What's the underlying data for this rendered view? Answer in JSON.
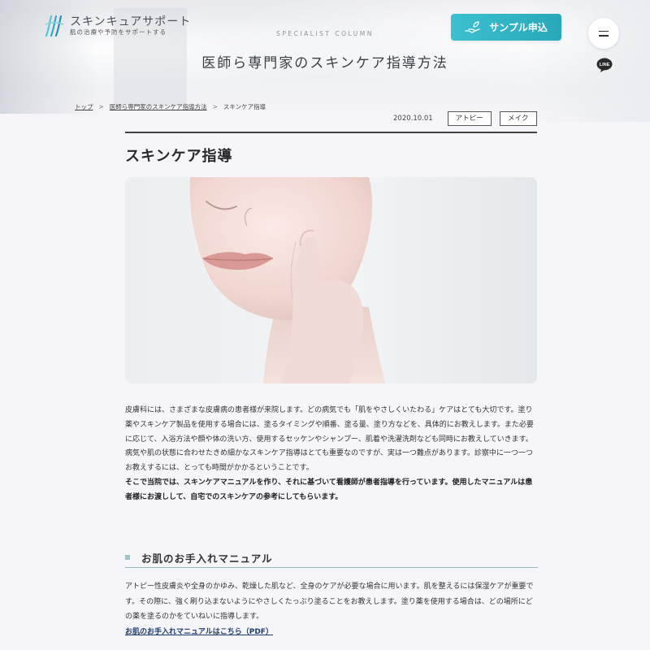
{
  "brand": {
    "name": "スキンキュアサポート",
    "tagline": "肌の治療や予防をサポートする"
  },
  "header": {
    "sample_button_label": "サンプル申込",
    "line_label": "LINE"
  },
  "hero": {
    "eyebrow": "SPECIALIST COLUMN",
    "title": "医師ら専門家のスキンケア指導方法"
  },
  "breadcrumb": {
    "items": [
      "トップ",
      "医師ら専門家のスキンケア指導方法",
      "スキンケア指導"
    ],
    "separator": ">"
  },
  "meta": {
    "date": "2020.10.01",
    "tags": [
      "アトピー",
      "メイク"
    ]
  },
  "article": {
    "title": "スキンケア指導",
    "paragraphs": [
      "皮膚科には、さまざまな皮膚病の患者様が来院します。どの病気でも「肌をやさしくいたわる」ケアはとても大切です。塗り薬やスキンケア製品を使用する場合には、塗るタイミングや順番、塗る量、塗り方などを、具体的にお教えします。また必要に応じて、入浴方法や顔や体の洗い方、使用するセッケンやシャンプー、肌着や洗濯洗剤なども同時にお教えしていきます。",
      "病気や肌の状態に合わせたきめ細かなスキンケア指導はとても重要なのですが、実は一つ難点があります。診察中に一つ一つお教えするには、とっても時間がかかるということです。",
      "そこで当院では、スキンケアマニュアルを作り、それに基づいて看護師が患者指導を行っています。使用したマニュアルは患者様にお渡しして、自宅でのスキンケアの参考にしてもらいます。"
    ]
  },
  "section": {
    "heading": "お肌のお手入れマニュアル",
    "text": "アトピー性皮膚炎や全身のかゆみ、乾燥した肌など、全身のケアが必要な場合に用います。肌を整えるには保湿ケアが重要です。その際に、強く刷り込まないようにやさしくたっぷり塗ることをお教えします。塗り薬を使用する場合は、どの場所にどの薬を塗るのかをていねいに指導します。",
    "link_label": "お肌のお手入れマニュアルはこちら（PDF）"
  },
  "colors": {
    "accent": "#2fb3c4",
    "heading_rule": "#8fb9bd",
    "link": "#1e3c6e"
  }
}
